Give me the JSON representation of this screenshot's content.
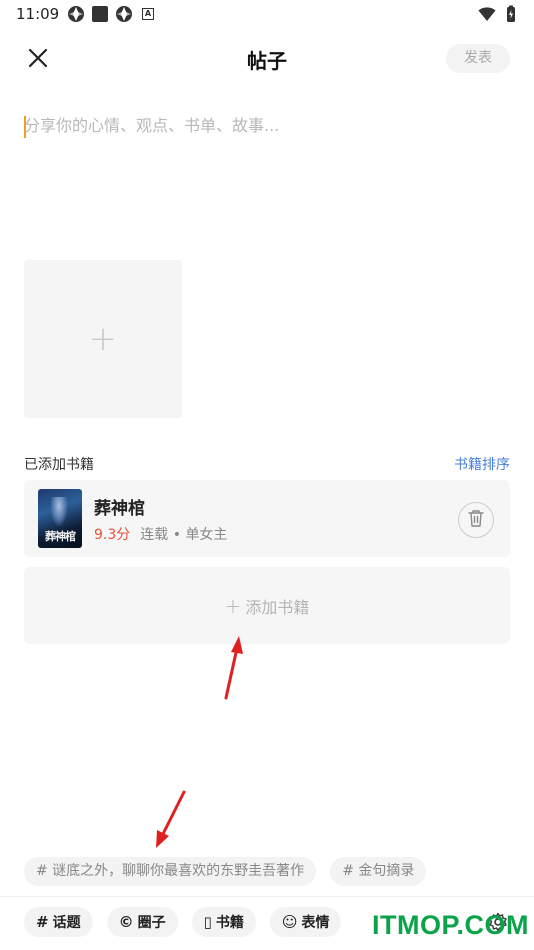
{
  "status_bar": {
    "time": "11:09",
    "left_icons": [
      "aperture-icon",
      "square-icon",
      "aperture-icon",
      "a-box-icon"
    ],
    "right_icons": [
      "wifi-icon",
      "battery-charging-icon"
    ]
  },
  "header": {
    "title": "帖子",
    "publish_label": "发表"
  },
  "editor": {
    "placeholder": "分享你的心情、观点、书单、故事...",
    "value": ""
  },
  "image_picker": {
    "add_symbol": "+"
  },
  "books_section": {
    "label": "已添加书籍",
    "sort_label": "书籍排序",
    "items": [
      {
        "cover_text": "葬神棺",
        "title": "葬神棺",
        "score": "9.3分",
        "status": "连载",
        "separator": "•",
        "tag": "单女主"
      }
    ],
    "add_plus": "+",
    "add_label": "添加书籍"
  },
  "topic_suggestions": [
    "# 谜底之外，聊聊你最喜欢的东野圭吾著作",
    "# 金句摘录"
  ],
  "toolbar": {
    "items": [
      {
        "icon": "#",
        "label": "话题"
      },
      {
        "icon": "©",
        "label": "圈子"
      },
      {
        "icon": "▯",
        "label": "书籍"
      },
      {
        "icon": "☺",
        "label": "表情"
      }
    ]
  },
  "watermark": {
    "text": "ITMOP.COM"
  },
  "colors": {
    "accent_blue": "#4a7fd6",
    "score_red": "#e8513b",
    "chip_bg": "#f3f3f3",
    "watermark_green": "#0aa34a",
    "annotation_red": "#e02020"
  }
}
